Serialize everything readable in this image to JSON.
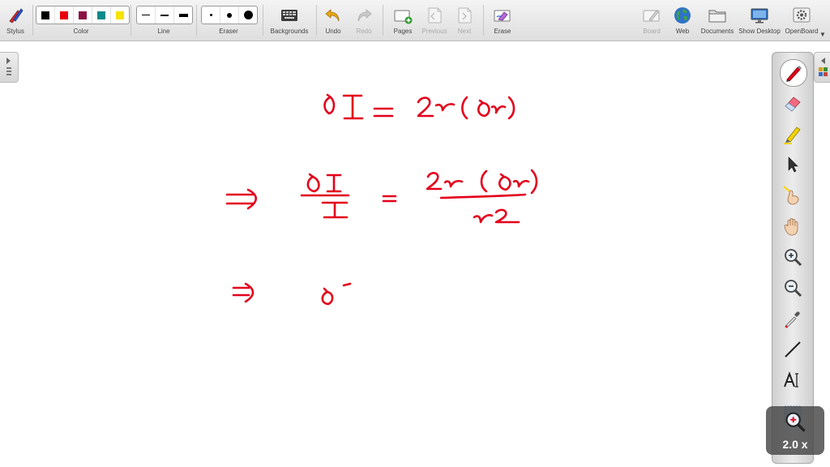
{
  "toolbar": {
    "stylus": "Stylus",
    "color": "Color",
    "line": "Line",
    "eraser": "Eraser",
    "backgrounds": "Backgrounds",
    "undo": "Undo",
    "redo": "Redo",
    "pages": "Pages",
    "previous": "Previous",
    "next": "Next",
    "erase": "Erase",
    "board": "Board",
    "web": "Web",
    "documents": "Documents",
    "show_desktop": "Show Desktop",
    "openboard": "OpenBoard"
  },
  "colors": {
    "swatches": [
      "#000000",
      "#e8000b",
      "#8b0f45",
      "#0b8a8a",
      "#f5e300"
    ],
    "ink": "#e3001b"
  },
  "stylus_palette": {
    "tools": [
      "pen-icon",
      "eraser-icon",
      "highlighter-icon",
      "selector-icon",
      "laser-pointer-icon",
      "hand-icon",
      "zoom-in-icon",
      "zoom-out-icon",
      "color-picker-icon",
      "line-icon",
      "text-icon",
      "capture-icon"
    ]
  },
  "zoom": {
    "level": "2.0 x"
  }
}
